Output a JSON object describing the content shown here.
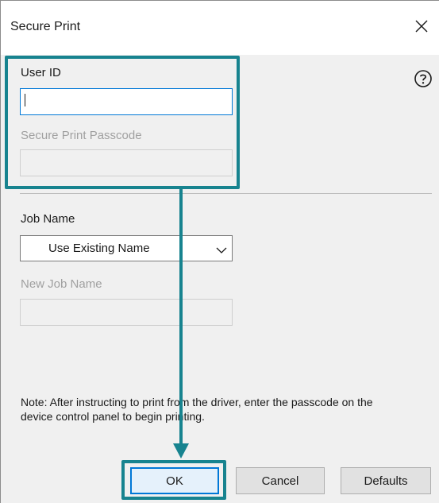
{
  "window": {
    "title": "Secure Print",
    "close_icon": "close-icon",
    "help_icon": "help-icon"
  },
  "user_id": {
    "label": "User ID",
    "value": ""
  },
  "passcode": {
    "label": "Secure Print Passcode",
    "value": ""
  },
  "job_name": {
    "label": "Job Name",
    "selected": "Use Existing Name"
  },
  "new_job_name": {
    "label": "New Job Name",
    "value": ""
  },
  "note": "Note: After instructing to print from the driver, enter the passcode on the device control panel to begin printing.",
  "buttons": {
    "ok": "OK",
    "cancel": "Cancel",
    "defaults": "Defaults"
  },
  "annotation": {
    "color": "#17838f"
  }
}
